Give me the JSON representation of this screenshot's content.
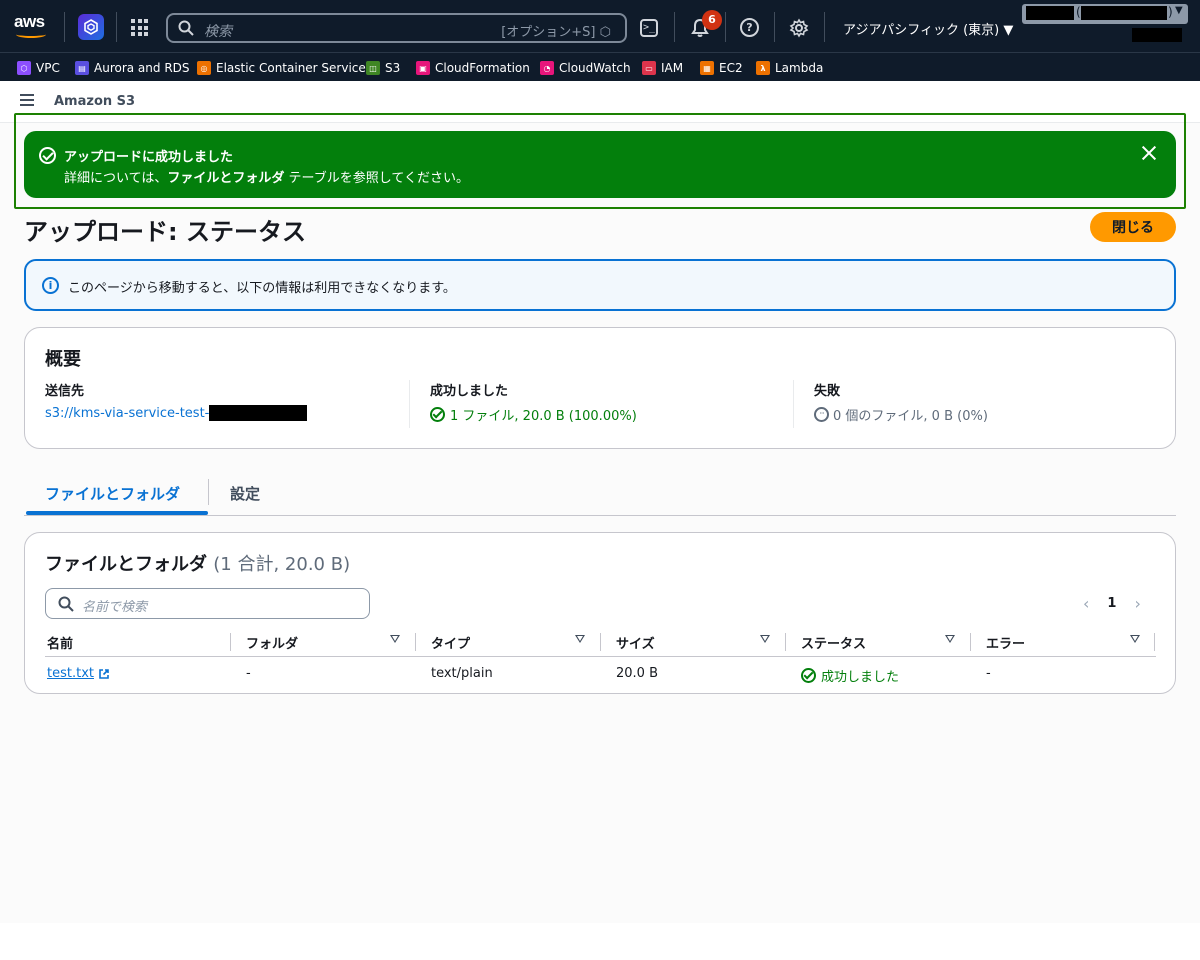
{
  "topnav": {
    "search_placeholder": "検索",
    "search_shortcut": "[オプション+S]",
    "notification_count": "6",
    "region": "アジアパシフィック (東京) ▼",
    "account_paren_open": "(",
    "account_paren_close": ")"
  },
  "favorites": [
    {
      "label": "VPC",
      "color": "#8c4fff"
    },
    {
      "label": "Aurora and RDS",
      "color": "#5a4fe0"
    },
    {
      "label": "Elastic Container Service",
      "color": "#ed7100"
    },
    {
      "label": "S3",
      "color": "#3f8624"
    },
    {
      "label": "CloudFormation",
      "color": "#e7157b"
    },
    {
      "label": "CloudWatch",
      "color": "#e7157b"
    },
    {
      "label": "IAM",
      "color": "#dd344c"
    },
    {
      "label": "EC2",
      "color": "#ed7100"
    },
    {
      "label": "Lambda",
      "color": "#ed7100"
    }
  ],
  "service": {
    "name": "Amazon S3"
  },
  "flash": {
    "title": "アップロードに成功しました",
    "detail_prefix": "詳細については、",
    "detail_bold": "ファイルとフォルダ",
    "detail_suffix": " テーブルを参照してください。"
  },
  "page": {
    "title": "アップロード: ステータス",
    "close_label": "閉じる"
  },
  "info": {
    "text": "このページから移動すると、以下の情報は利用できなくなります。"
  },
  "summary": {
    "heading": "概要",
    "destination_label": "送信先",
    "destination_value": "s3://kms-via-service-test-",
    "succeeded_label": "成功しました",
    "succeeded_value": "1 ファイル, 20.0 B (100.00%)",
    "failed_label": "失敗",
    "failed_value": "0 個のファイル, 0 B (0%)"
  },
  "tabs": [
    {
      "label": "ファイルとフォルダ",
      "active": true
    },
    {
      "label": "設定",
      "active": false
    }
  ],
  "files": {
    "heading": "ファイルとフォルダ",
    "count": "(1 合計, 20.0 B)",
    "search_placeholder": "名前で検索",
    "page": "1",
    "columns": [
      "名前",
      "フォルダ",
      "タイプ",
      "サイズ",
      "ステータス",
      "エラー"
    ],
    "rows": [
      {
        "name": "test.txt",
        "folder": "-",
        "type": "text/plain",
        "size": "20.0 B",
        "status": "成功しました",
        "error": "-"
      }
    ]
  },
  "colors": {
    "nav_bg": "#0f1b2a",
    "success": "#037f0c",
    "link": "#0972d3",
    "primary_button": "#ff9900"
  }
}
